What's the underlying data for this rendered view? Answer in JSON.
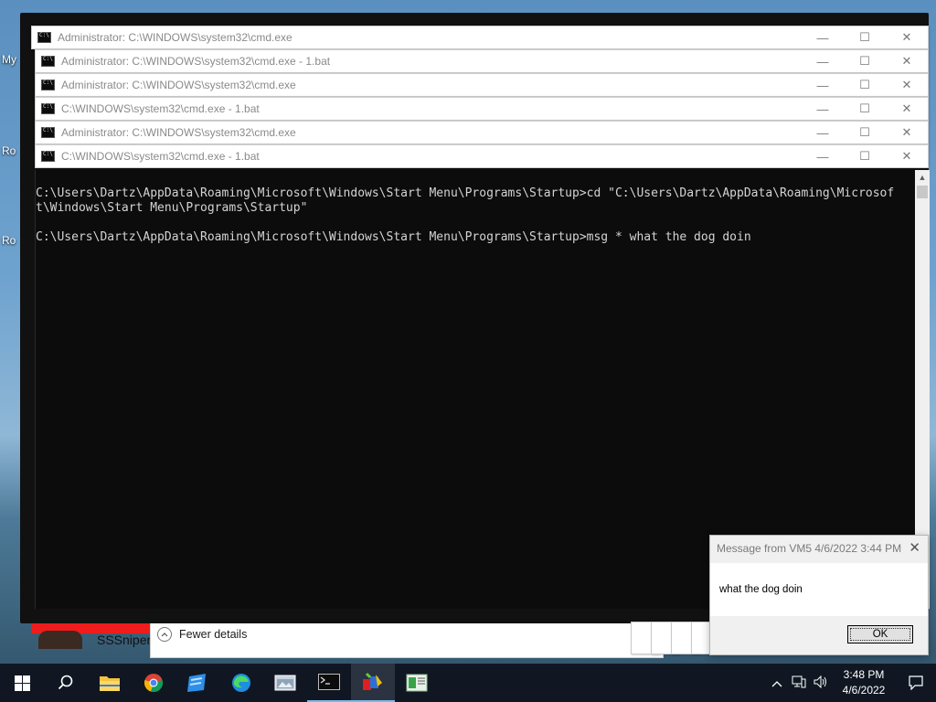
{
  "desktop": {
    "icon_labels": [
      "My",
      "Ro",
      "Ro"
    ]
  },
  "background_app": {
    "user_name": "SSSniper",
    "fewer_details_label": "Fewer details"
  },
  "windows": [
    {
      "title": "Administrator: C:\\WINDOWS\\system32\\cmd.exe"
    },
    {
      "title": "Administrator: C:\\WINDOWS\\system32\\cmd.exe - 1.bat"
    },
    {
      "title": "Administrator: C:\\WINDOWS\\system32\\cmd.exe"
    },
    {
      "title": "C:\\WINDOWS\\system32\\cmd.exe - 1.bat"
    },
    {
      "title": "Administrator: C:\\WINDOWS\\system32\\cmd.exe"
    },
    {
      "title": "C:\\WINDOWS\\system32\\cmd.exe - 1.bat"
    }
  ],
  "window_controls": {
    "minimize": "—",
    "maximize": "☐",
    "close": "✕"
  },
  "console": {
    "lines": [
      "C:\\Users\\Dartz\\AppData\\Roaming\\Microsoft\\Windows\\Start Menu\\Programs\\Startup>cd \"C:\\Users\\Dartz\\AppData\\Roaming\\Microsof",
      "t\\Windows\\Start Menu\\Programs\\Startup\"",
      "",
      "C:\\Users\\Dartz\\AppData\\Roaming\\Microsoft\\Windows\\Start Menu\\Programs\\Startup>msg * what the dog doin"
    ]
  },
  "message_box": {
    "title": "Message from VM5 4/6/2022 3:44 PM",
    "text": "what the dog doin",
    "ok_label": "OK"
  },
  "taskbar": {
    "apps": [
      {
        "icon": "start-icon"
      },
      {
        "icon": "search-icon"
      },
      {
        "icon": "file-explorer-icon"
      },
      {
        "icon": "chrome-icon"
      },
      {
        "icon": "app-blue-icon"
      },
      {
        "icon": "edge-icon"
      },
      {
        "icon": "app-window-icon"
      },
      {
        "icon": "cmd-icon"
      },
      {
        "icon": "paint-icon"
      },
      {
        "icon": "app-green-icon"
      }
    ],
    "clock": {
      "time": "3:48 PM",
      "date": "4/6/2022"
    }
  },
  "colors": {
    "console_bg": "#0c0c0c",
    "console_text": "#d4d4d4",
    "taskbar_bg": "#101722",
    "accent": "#76b9ed"
  }
}
